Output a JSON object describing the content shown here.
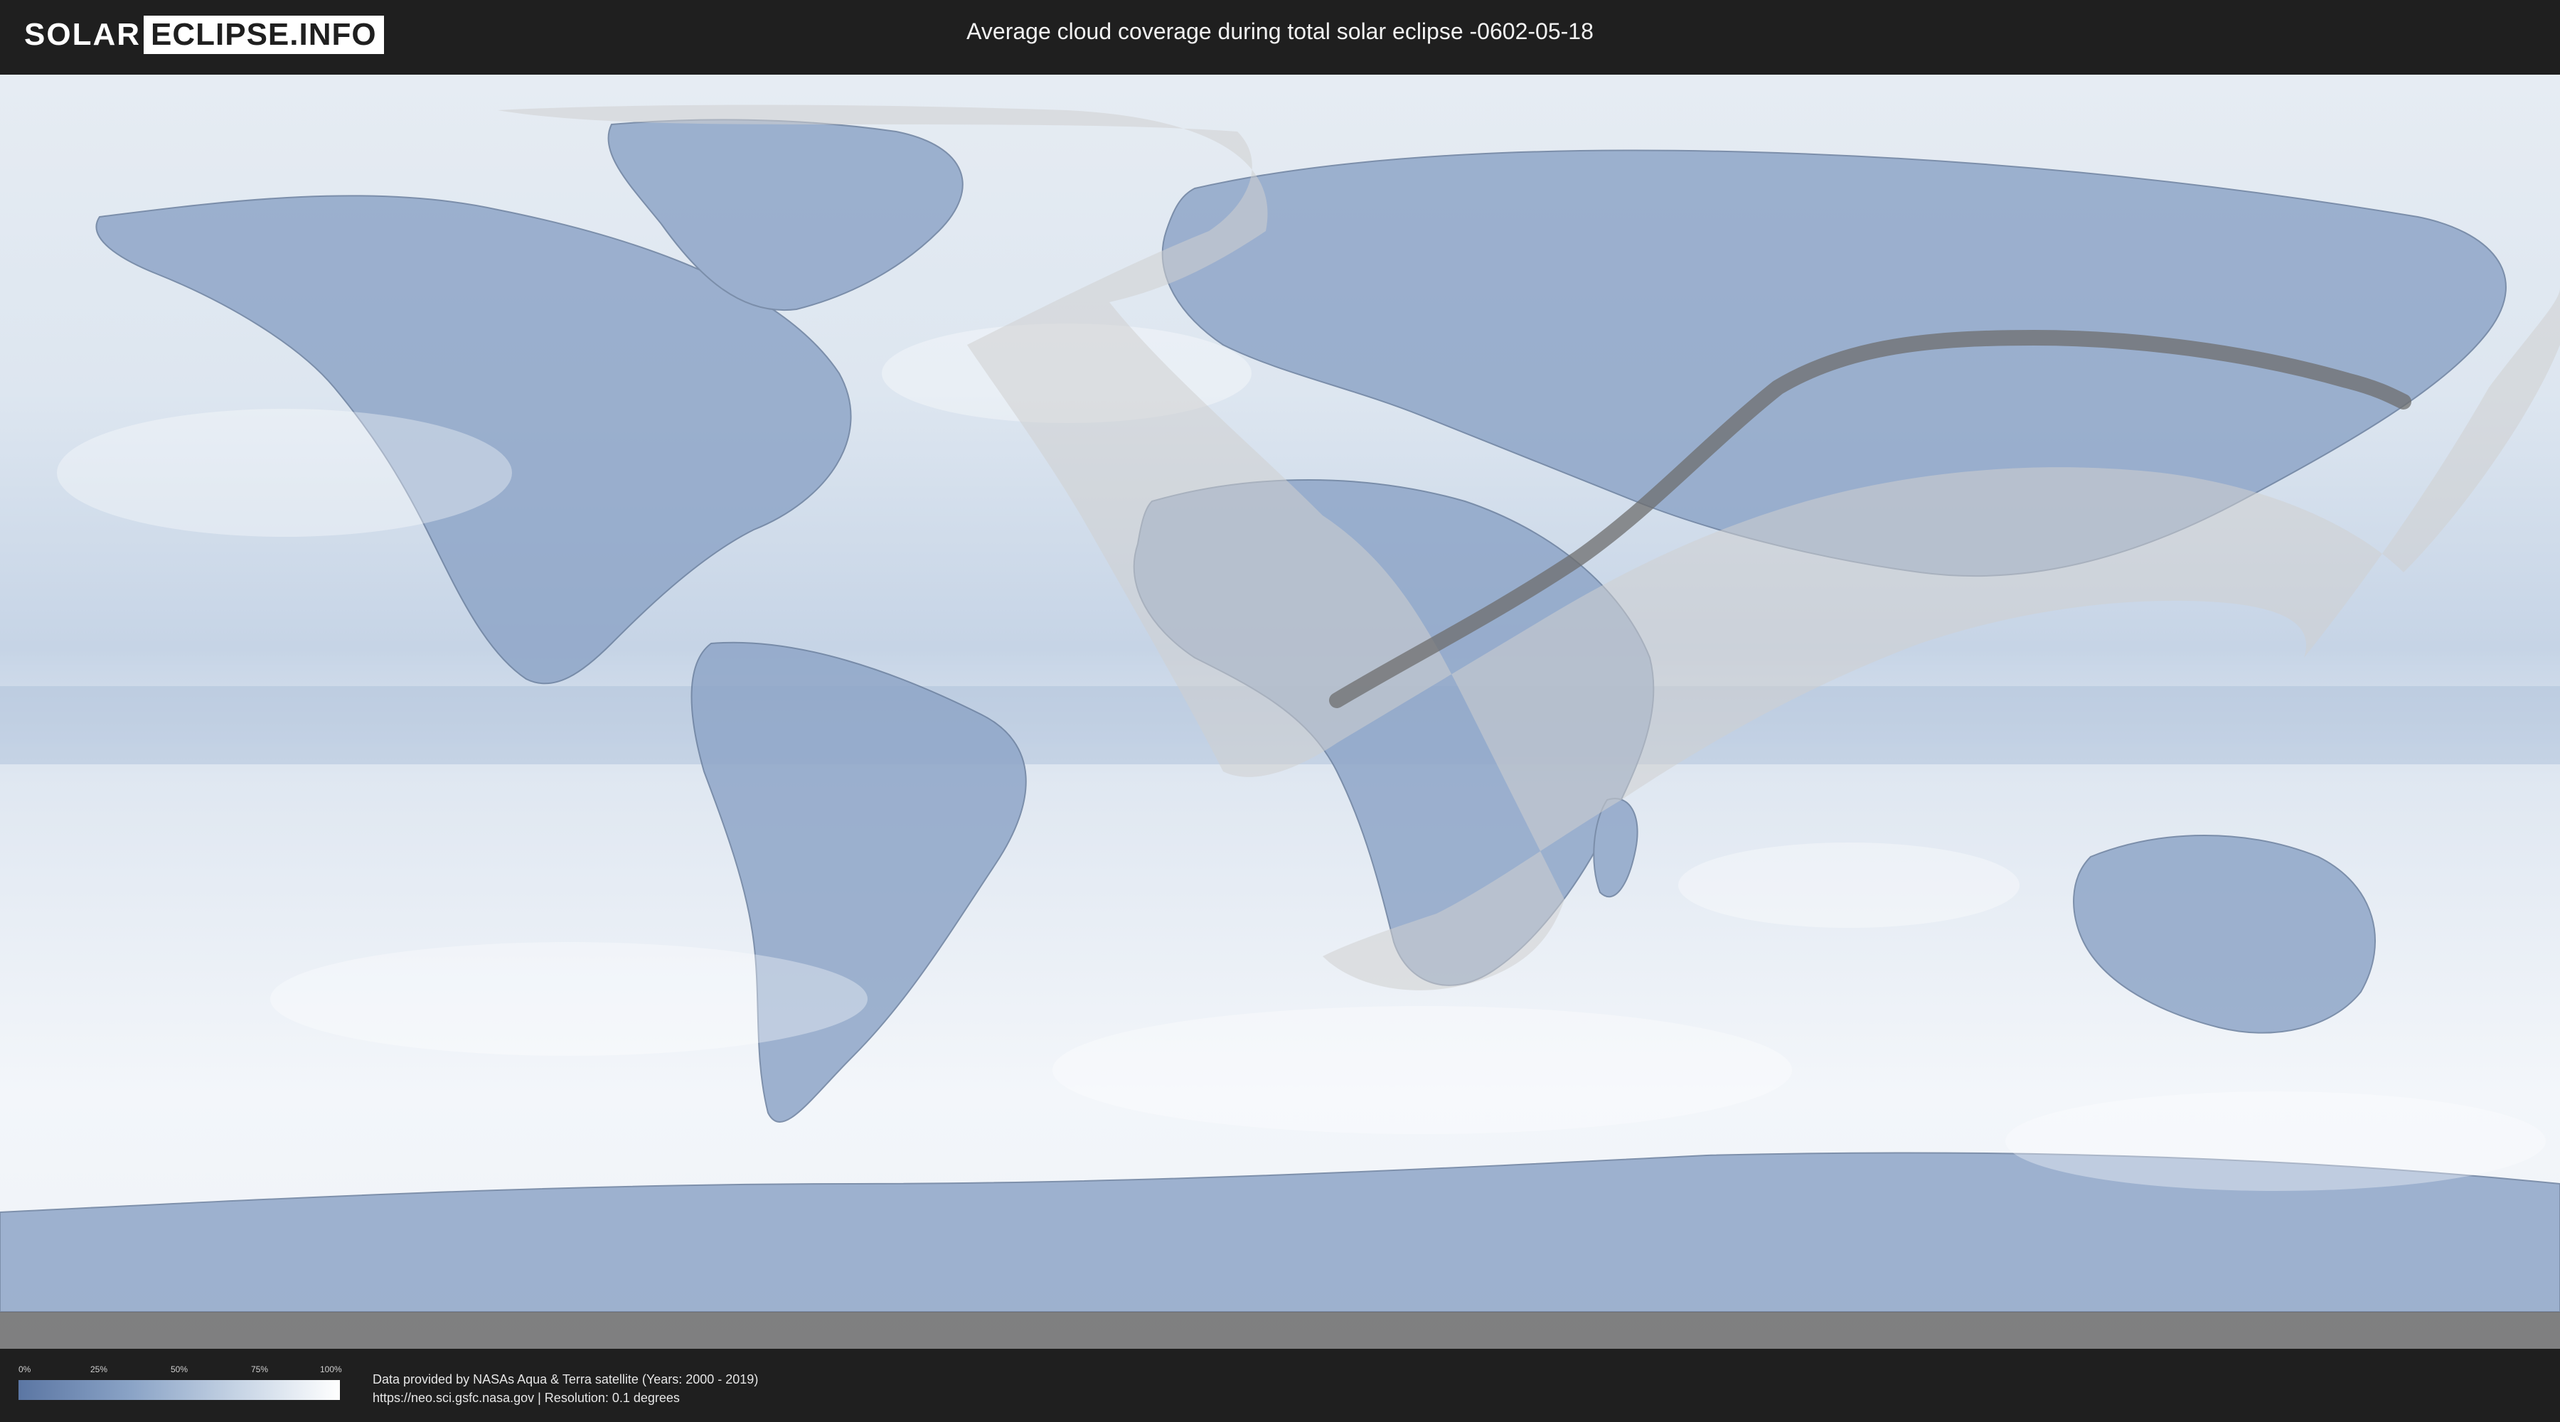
{
  "header": {
    "logo_solar": "SOLAR",
    "logo_eclipse": "ECLIPSE.INFO",
    "title": "Average cloud coverage during total solar eclipse -0602-05-18"
  },
  "legend": {
    "ticks": [
      "0%",
      "25%",
      "50%",
      "75%",
      "100%"
    ],
    "colors": {
      "low": "#5b76a3",
      "high": "#ffffff"
    }
  },
  "footer": {
    "line1": "Data provided by NASAs Aqua & Terra satellite (Years: 2000 - 2019)",
    "line2": "https://neo.sci.gsfc.nasa.gov | Resolution: 0.1 degrees"
  },
  "map": {
    "ocean_color": "#e9eef4",
    "land_cloud_color": "#8aa1c4",
    "penumbra_color": "#cfcfcf",
    "umbra_path_color": "#6e6e6e"
  }
}
